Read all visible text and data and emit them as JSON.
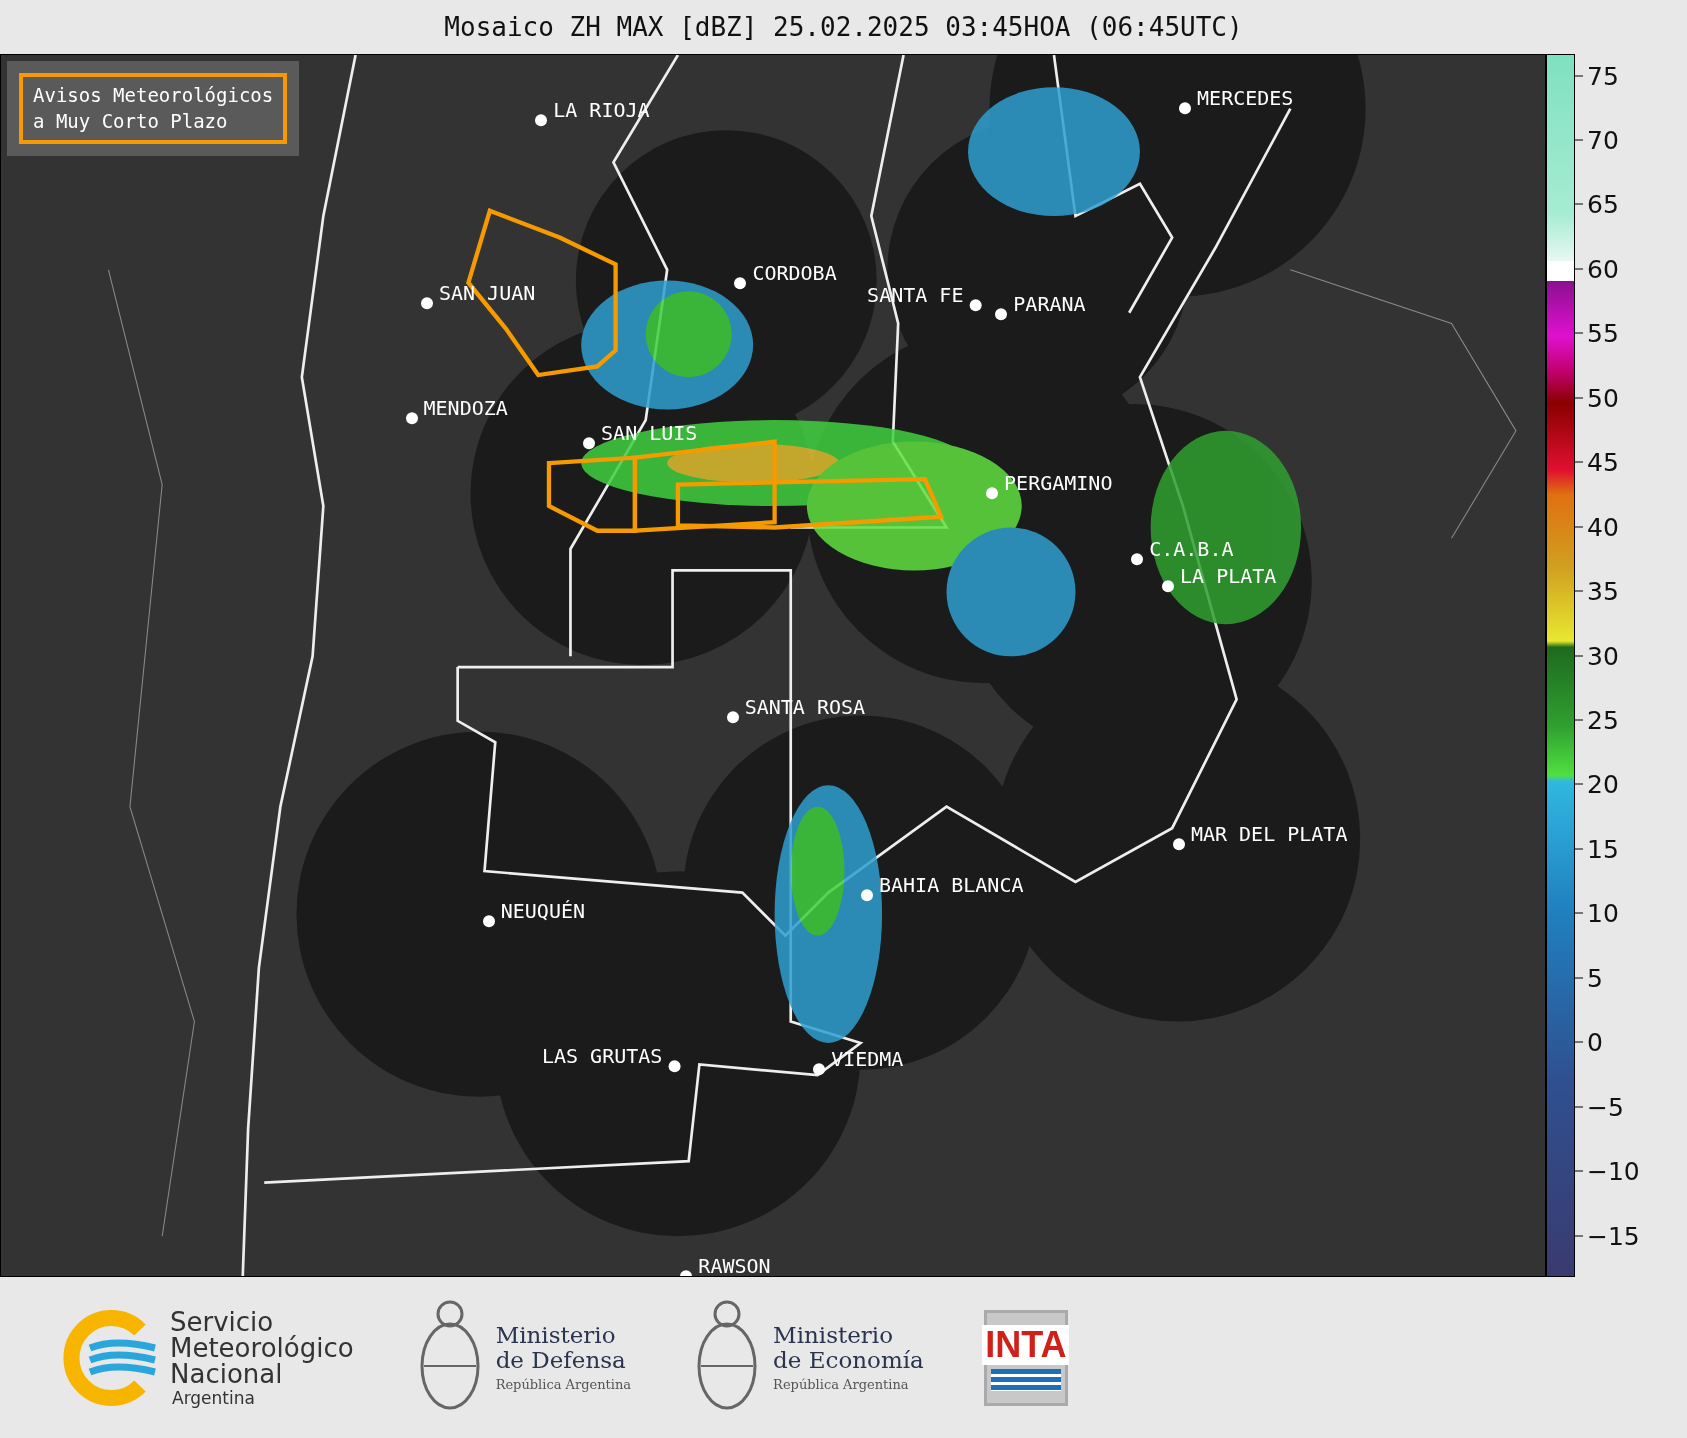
{
  "title": "Mosaico ZH MAX [dBZ] 25.02.2025 03:45HOA (06:45UTC)",
  "legend": {
    "lines": [
      "Avisos Meteorológicos",
      "a Muy Corto Plazo"
    ]
  },
  "cities": [
    {
      "name": "LA RIOJA"
    },
    {
      "name": "MERCEDES"
    },
    {
      "name": "CORDOBA"
    },
    {
      "name": "SAN JUAN"
    },
    {
      "name": "SANTA FE"
    },
    {
      "name": "PARANA"
    },
    {
      "name": "MENDOZA"
    },
    {
      "name": "SAN LUIS"
    },
    {
      "name": "PERGAMINO"
    },
    {
      "name": "C.A.B.A"
    },
    {
      "name": "LA PLATA"
    },
    {
      "name": "SANTA ROSA"
    },
    {
      "name": "MAR DEL PLATA"
    },
    {
      "name": "BAHIA BLANCA"
    },
    {
      "name": "NEUQUÉN"
    },
    {
      "name": "LAS GRUTAS"
    },
    {
      "name": "VIEDMA"
    },
    {
      "name": "RAWSON"
    }
  ],
  "colorbar": {
    "ticks": [
      "75",
      "70",
      "65",
      "60",
      "55",
      "50",
      "45",
      "40",
      "35",
      "30",
      "25",
      "20",
      "15",
      "10",
      "5",
      "0",
      "−5",
      "−10",
      "−15"
    ]
  },
  "footer": {
    "smn": {
      "lines": [
        "Servicio",
        "Meteorológico",
        "Nacional"
      ],
      "country": "Argentina"
    },
    "ministries": [
      {
        "lines": [
          "Ministerio",
          "de Defensa"
        ],
        "country": "República Argentina"
      },
      {
        "lines": [
          "Ministerio",
          "de Economía"
        ],
        "country": "República Argentina"
      }
    ],
    "inta": "INTA"
  }
}
